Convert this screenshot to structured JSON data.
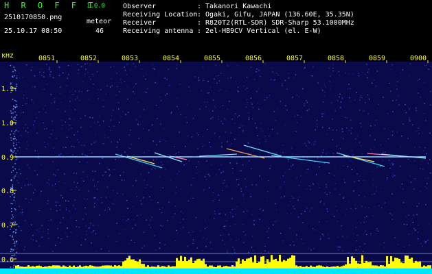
{
  "header": {
    "app_title": "H R O F F T",
    "app_version": "1.0.0",
    "filename": "2510170850.png",
    "timestamp": "25.10.17 08:50",
    "meteor_label": "meteor",
    "meteor_count": "46"
  },
  "info": {
    "observer_label": "Observer",
    "observer_value": ": Takanori Kawachi",
    "location_label": "Receiving Location",
    "location_value": ": Ogaki, Gifu, JAPAN (136.60E, 35.35N)",
    "receiver_label": "Receiver",
    "receiver_value": ": R820T2(RTL-SDR) SDR-Sharp 53.1000MHz",
    "antenna_label": "Receiving antenna",
    "antenna_value": ": 2el-HB9CV Vertical (el. E-W)"
  },
  "spectrogram": {
    "y_unit": "kHz",
    "y_ticks": [
      "1.1",
      "1.0",
      "0.9",
      "0.8",
      "0.7",
      "0.6"
    ],
    "time_ticks": [
      "0851",
      "0852",
      "0853",
      "0854",
      "0855",
      "0856",
      "0857",
      "0858",
      "0859",
      "0900"
    ],
    "colors": {
      "background": "#0a0a4a",
      "noise": "#2a3ab0",
      "tick_text": "#ffff00",
      "carrier": "#9ad8ff",
      "power_bar": "#ffff00",
      "baseline": "#00e5ff"
    }
  }
}
